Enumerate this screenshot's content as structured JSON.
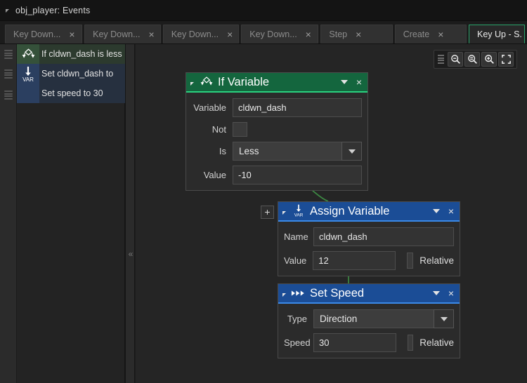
{
  "window": {
    "title": "obj_player: Events",
    "collapse_icon": "triangle-collapse-icon"
  },
  "tabs": [
    {
      "label": "Key Down...",
      "close": "×",
      "active": false
    },
    {
      "label": "Key Down...",
      "close": "×",
      "active": false
    },
    {
      "label": "Key Down...",
      "close": "×",
      "active": false
    },
    {
      "label": "Key Down...",
      "close": "×",
      "active": false
    },
    {
      "label": "Step",
      "close": "×",
      "active": false
    },
    {
      "label": "Create",
      "close": "×",
      "active": false
    },
    {
      "label": "Key Up - S.",
      "close": "",
      "active": true
    }
  ],
  "action_list": [
    {
      "label": "If cldwn_dash is less",
      "icon": "branch-icon",
      "color": "#35513a"
    },
    {
      "label": "Set cldwn_dash to",
      "icon": "var-assign-icon",
      "color": "#2b3f60"
    },
    {
      "label": "Set speed to 30",
      "icon": "",
      "color": "#2b3f60"
    }
  ],
  "splitter": {
    "collapse_label": "«"
  },
  "toolbar": {
    "grip": "drag-handle-icon",
    "buttons": [
      {
        "name": "zoom-out-button",
        "icon": "magnifier-minus-icon"
      },
      {
        "name": "zoom-reset-button",
        "icon": "magnifier-equal-icon"
      },
      {
        "name": "zoom-in-button",
        "icon": "magnifier-plus-icon"
      },
      {
        "name": "fit-to-screen-button",
        "icon": "frame-brackets-icon"
      }
    ]
  },
  "add_action_button": {
    "label": "+"
  },
  "nodes": {
    "if_variable": {
      "title": "If Variable",
      "icon": "branch-icon",
      "header_color": "#14663e",
      "accent_color": "#2ad17f",
      "caret": "chevron-down-icon",
      "close": "×",
      "fields": {
        "variable_label": "Variable",
        "variable_value": "cldwn_dash",
        "not_label": "Not",
        "not_checked": false,
        "is_label": "Is",
        "is_value": "Less",
        "value_label": "Value",
        "value_value": "-10"
      }
    },
    "assign_variable": {
      "title": "Assign Variable",
      "icon": "var-assign-icon",
      "header_color": "#1b4d96",
      "accent_color": "#3b8ae8",
      "caret": "chevron-down-icon",
      "close": "×",
      "fields": {
        "name_label": "Name",
        "name_value": "cldwn_dash",
        "value_label": "Value",
        "value_value": "12",
        "relative_label": "Relative",
        "relative_checked": false
      }
    },
    "set_speed": {
      "title": "Set Speed",
      "icon": "fast-forward-icon",
      "header_color": "#1b4d96",
      "accent_color": "#3b8ae8",
      "caret": "chevron-down-icon",
      "close": "×",
      "fields": {
        "type_label": "Type",
        "type_value": "Direction",
        "speed_label": "Speed",
        "speed_value": "30",
        "relative_label": "Relative",
        "relative_checked": false
      }
    }
  },
  "connector_color": "#3d8a43"
}
